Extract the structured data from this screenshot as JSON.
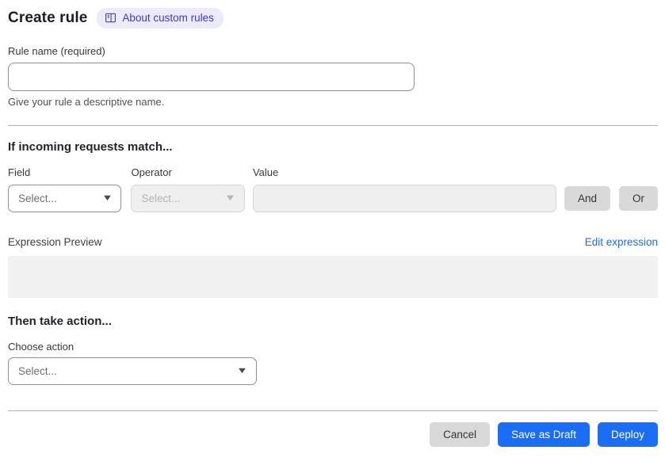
{
  "page": {
    "title": "Create rule"
  },
  "header": {
    "about_link": {
      "label": "About custom rules",
      "icon": "book-icon"
    }
  },
  "rule_name": {
    "label": "Rule name (required)",
    "value": "",
    "helper": "Give your rule a descriptive name."
  },
  "match_section": {
    "heading": "If incoming requests match...",
    "field": {
      "label": "Field",
      "value": "Select...",
      "enabled": true
    },
    "operator": {
      "label": "Operator",
      "value": "Select...",
      "enabled": false
    },
    "value": {
      "label": "Value",
      "value": "",
      "enabled": false
    },
    "and_button": "And",
    "or_button": "Or"
  },
  "expression": {
    "label": "Expression Preview",
    "edit_link": "Edit expression",
    "value": ""
  },
  "action_section": {
    "heading": "Then take action...",
    "choose_label": "Choose action",
    "value": "Select..."
  },
  "footer": {
    "cancel": "Cancel",
    "save_draft": "Save as Draft",
    "deploy": "Deploy"
  },
  "colors": {
    "accent_blue": "#1a6ef5",
    "badge_bg": "#ecebfb",
    "badge_text": "#4338ca",
    "link_blue": "#1a6ef5",
    "gray_button_bg": "#d9d9d9",
    "disabled_bg": "#efefef",
    "divider": "#b0b0b0",
    "preview_bg": "#f1f1f1"
  }
}
